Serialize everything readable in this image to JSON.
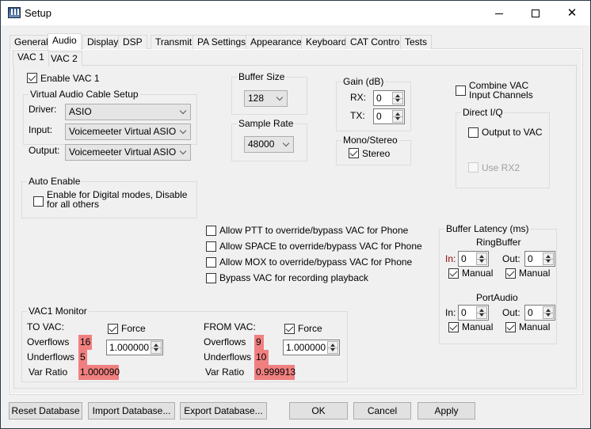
{
  "window": {
    "title": "Setup",
    "controls": {
      "minimize": "minimize-icon",
      "maximize": "maximize-icon",
      "close": "close-icon"
    }
  },
  "tabs": [
    {
      "label": "General"
    },
    {
      "label": "Audio",
      "active": true
    },
    {
      "label": "Display"
    },
    {
      "label": "DSP"
    },
    {
      "label": "Transmit"
    },
    {
      "label": "PA Settings"
    },
    {
      "label": "Appearance"
    },
    {
      "label": "Keyboard"
    },
    {
      "label": "CAT Control"
    },
    {
      "label": "Tests"
    }
  ],
  "subtabs": [
    {
      "label": "VAC 1",
      "active": true
    },
    {
      "label": "VAC 2"
    }
  ],
  "vac": {
    "enable_label": "Enable VAC 1",
    "enable_checked": true,
    "cable_setup": {
      "title": "Virtual Audio Cable Setup",
      "driver_label": "Driver:",
      "driver_value": "ASIO",
      "input_label": "Input:",
      "input_value": "Voicemeeter Virtual ASIO",
      "output_label": "Output:",
      "output_value": "Voicemeeter Virtual ASIO"
    },
    "buffer_size": {
      "title": "Buffer Size",
      "value": "128"
    },
    "sample_rate": {
      "title": "Sample Rate",
      "value": "48000"
    },
    "gain": {
      "title": "Gain (dB)",
      "rx_label": "RX:",
      "rx_value": "0",
      "tx_label": "TX:",
      "tx_value": "0"
    },
    "mono_stereo": {
      "title": "Mono/Stereo",
      "stereo_label": "Stereo",
      "stereo_checked": true
    },
    "combine": {
      "label_line1": "Combine VAC",
      "label_line2": "Input Channels",
      "checked": false
    },
    "direct_iq": {
      "title": "Direct I/Q",
      "output_label": "Output to VAC",
      "output_checked": false,
      "use_rx2_label": "Use RX2",
      "use_rx2_checked": false,
      "use_rx2_disabled": true
    },
    "auto_enable": {
      "title": "Auto Enable",
      "label_line1": "Enable for Digital modes, Disable",
      "label_line2": "for all others",
      "checked": false
    },
    "options": [
      {
        "label": "Allow PTT to override/bypass VAC for Phone",
        "checked": false
      },
      {
        "label": "Allow SPACE to override/bypass VAC for Phone",
        "checked": false
      },
      {
        "label": "Allow MOX to override/bypass VAC for Phone",
        "checked": false
      },
      {
        "label": "Bypass VAC for recording playback",
        "checked": false
      }
    ],
    "buffer_latency": {
      "title": "Buffer Latency (ms)",
      "ringbuffer": {
        "title": "RingBuffer",
        "in_label": "In:",
        "in_value": "0",
        "out_label": "Out:",
        "out_value": "0",
        "manual_label": "Manual",
        "in_manual": true,
        "out_manual": true
      },
      "portaudio": {
        "title": "PortAudio",
        "in_label": "In:",
        "in_value": "0",
        "out_label": "Out:",
        "out_value": "0",
        "manual_label": "Manual",
        "in_manual": true,
        "out_manual": true
      }
    },
    "monitor": {
      "title": "VAC1 Monitor",
      "to_vac": {
        "label": "TO VAC:",
        "force_label": "Force",
        "force_checked": true,
        "force_value": "1.000000",
        "overflows_label": "Overflows",
        "overflows": "16",
        "underflows_label": "Underflows",
        "underflows": "5",
        "var_ratio_label": "Var Ratio",
        "var_ratio": "1.000090"
      },
      "from_vac": {
        "label": "FROM VAC:",
        "force_label": "Force",
        "force_checked": true,
        "force_value": "1.000000",
        "overflows_label": "Overflows",
        "overflows": "9",
        "underflows_label": "Underflows",
        "underflows": "10",
        "var_ratio_label": "Var Ratio",
        "var_ratio": "0.999913"
      },
      "highlight_color": "#f08080"
    }
  },
  "footer": {
    "reset_label": "Reset Database",
    "import_label": "Import Database...",
    "export_label": "Export Database...",
    "ok_label": "OK",
    "cancel_label": "Cancel",
    "apply_label": "Apply"
  }
}
